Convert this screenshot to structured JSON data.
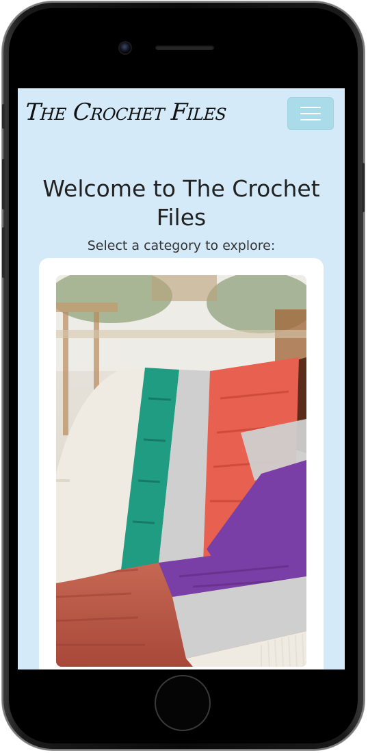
{
  "brand": "The Crochet Files",
  "menu": {
    "icon": "hamburger-menu-icon"
  },
  "welcome": {
    "title": "Welcome to The Crochet Files"
  },
  "subtitle": "Select a category to explore:",
  "category_card": {
    "image_subject": "blanket-photo-icon"
  },
  "colors": {
    "page_background": "#d4eaf8",
    "menu_button": "#a9dbe9",
    "card_background": "#ffffff",
    "blanket_teal": "#1f9c82",
    "blanket_coral": "#e8604f",
    "blanket_purple": "#7a3fa6",
    "blanket_grey": "#cfcfcf",
    "blanket_cream": "#efebe2"
  }
}
